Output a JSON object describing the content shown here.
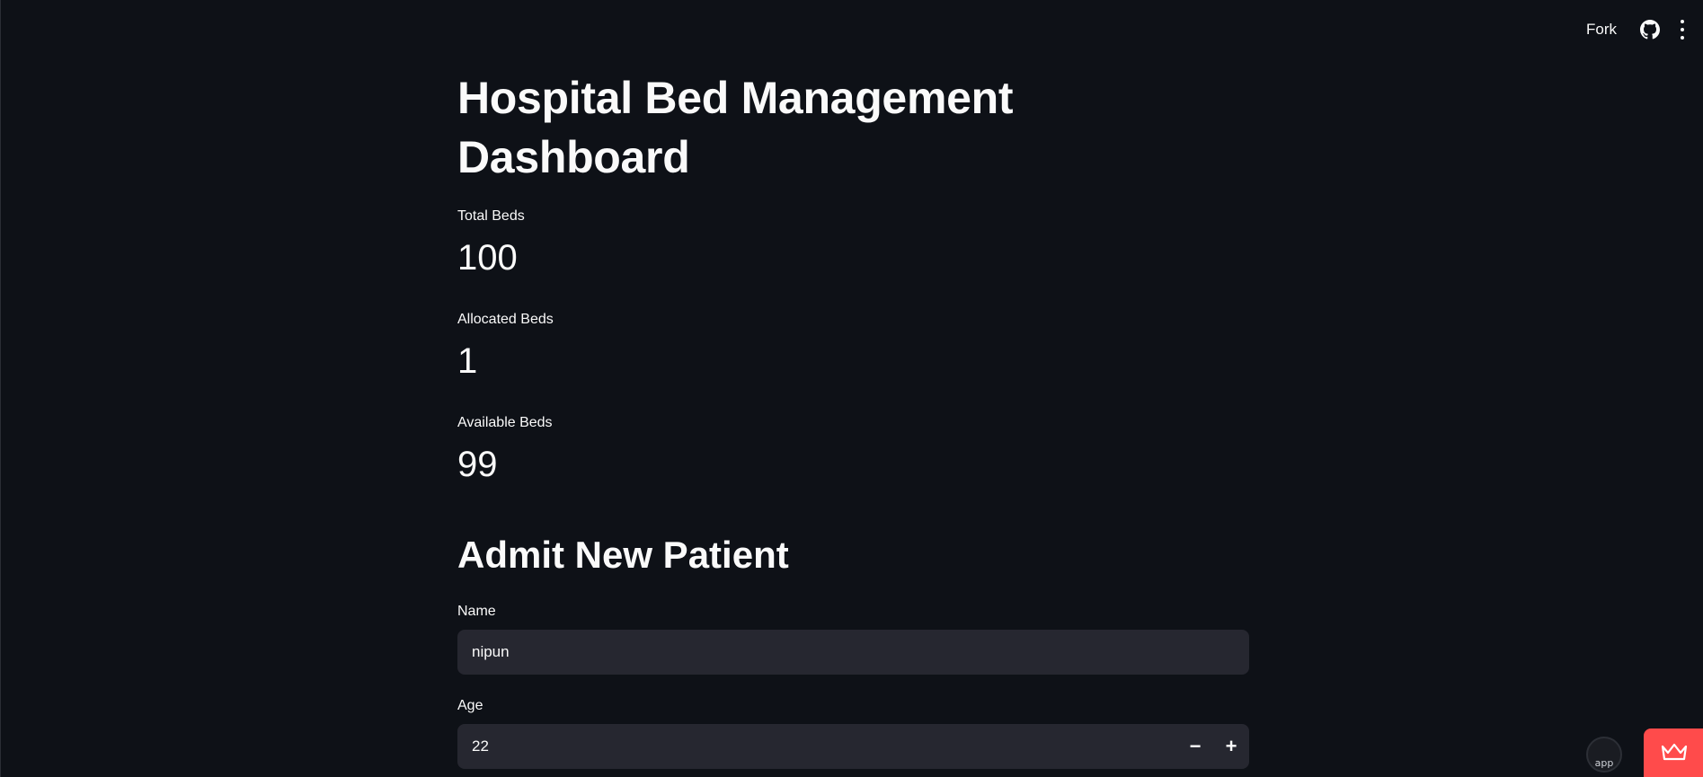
{
  "header": {
    "fork_label": "Fork",
    "github_icon": "github-icon",
    "menu_icon": "more-vertical-icon"
  },
  "page": {
    "title": "Hospital Bed Management Dashboard"
  },
  "metrics": [
    {
      "label": "Total Beds",
      "value": "100"
    },
    {
      "label": "Allocated Beds",
      "value": "1"
    },
    {
      "label": "Available Beds",
      "value": "99"
    }
  ],
  "admit_form": {
    "title": "Admit New Patient",
    "name_label": "Name",
    "name_value": "nipun",
    "age_label": "Age",
    "age_value": "22",
    "decrement_label": "−",
    "increment_label": "+"
  },
  "widgets": {
    "avatar_alt": "app",
    "badge_icon": "crown-icon",
    "badge_color": "#ff4b4b"
  }
}
